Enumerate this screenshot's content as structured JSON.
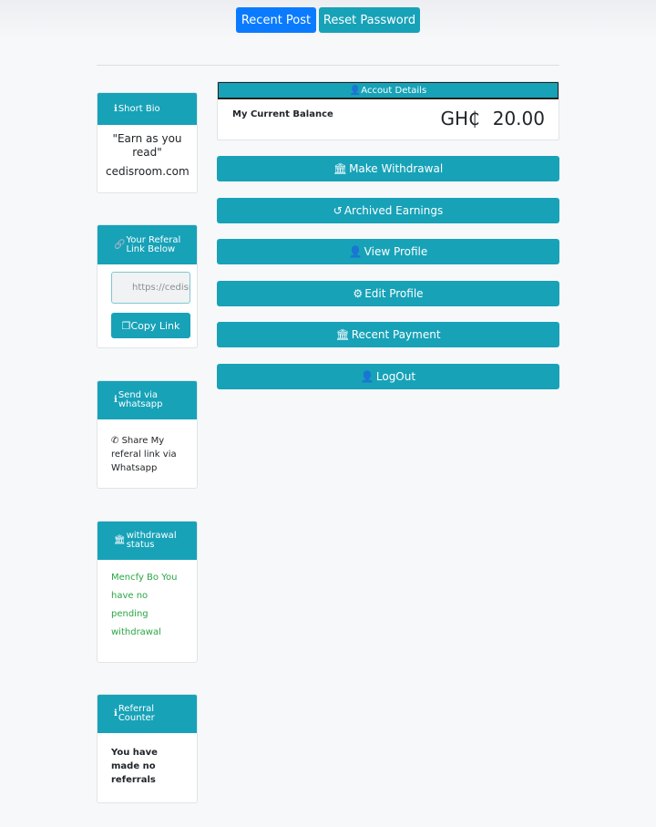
{
  "topnav": {
    "recent_post": "Recent Post",
    "reset_password": "Reset Password"
  },
  "sidebar": {
    "short_bio": {
      "title": "Short Bio",
      "quote": "\"Earn as you read\"",
      "site": "cedisroom.com"
    },
    "referral_link": {
      "title": "Your Referal Link Below",
      "input_value": "https://cedisroom.com",
      "copy_label": "Copy Link"
    },
    "whatsapp": {
      "title": "Send via whatsapp",
      "text": "Share My referal link via Whatsapp"
    },
    "withdrawal_status": {
      "title": "withdrawal status",
      "text": "Mencfy Bo You have no pending withdrawal"
    },
    "referral_counter": {
      "title": "Referral Counter",
      "text": "You have made no referrals"
    }
  },
  "account": {
    "header": "Accout Details",
    "balance_label": "My Current Balance",
    "currency": "GH₵",
    "balance": "20.00"
  },
  "actions": {
    "withdraw": "Make Withdrawal",
    "archived": "Archived Earnings",
    "view_profile": "View Profile",
    "edit_profile": "Edit Profile",
    "recent_payment": "Recent Payment",
    "logout": "LogOut"
  },
  "colors": {
    "primary": "#0a7bff",
    "teal": "#17a2b8",
    "success": "#28a745"
  }
}
